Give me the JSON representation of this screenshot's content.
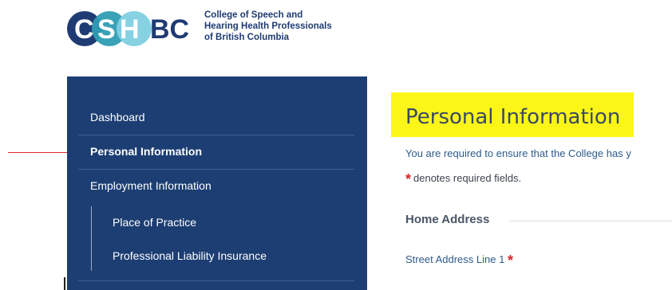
{
  "brand": {
    "logo_text": "CSHBC",
    "tagline_lines": [
      "College of Speech and",
      "Hearing Health Professionals",
      "of British Columbia"
    ],
    "colors": {
      "dark_blue": "#1f3b73",
      "teal": "#2f9db3",
      "light_blue": "#7fd0e0"
    }
  },
  "sidebar": {
    "items": [
      {
        "label": "Dashboard",
        "active": false
      },
      {
        "label": "Personal Information",
        "active": true
      },
      {
        "label": "Employment Information",
        "active": false
      }
    ],
    "sub_items": [
      {
        "label": "Place of Practice"
      },
      {
        "label": "Professional Liability Insurance"
      }
    ]
  },
  "main": {
    "title": "Personal Information",
    "intro": "You are required to ensure that the College has y",
    "required_asterisk": "*",
    "required_note": "denotes required fields.",
    "section_heading": "Home Address",
    "fields": [
      {
        "label": "Street Address Line 1",
        "required": true
      }
    ]
  },
  "annotations": {
    "highlight_color": "#fbf617",
    "arrow_color": "#e0282e"
  }
}
